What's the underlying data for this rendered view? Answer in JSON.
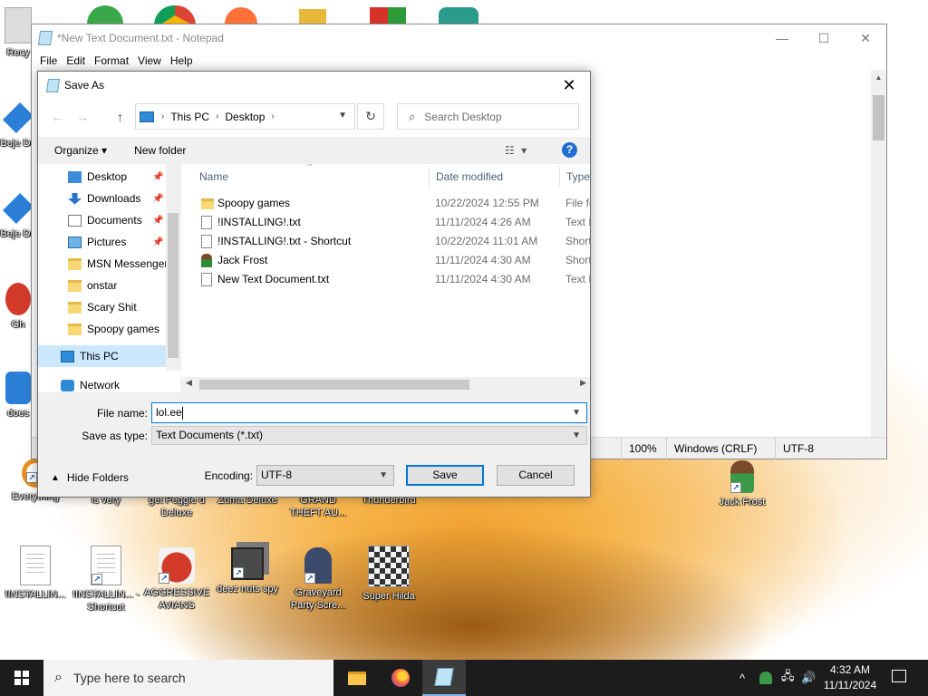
{
  "desktop": {
    "icons": [
      {
        "label": "Recy",
        "color": "#d9d9d9"
      },
      {
        "label": "Beje De",
        "color": "#2b7fd6"
      },
      {
        "label": "Beje De",
        "color": "#2b7fd6"
      },
      {
        "label": "Gh",
        "color": "#d23a2a"
      },
      {
        "label": "does",
        "color": "#2b7fd6"
      },
      {
        "label": "Everything",
        "color": "#e89020"
      },
      {
        "label": "is very",
        "color": "#ffffff"
      },
      {
        "label": "get Peggle d Deluxe",
        "color": "#ffffff"
      },
      {
        "label": "Zuma Deluxe",
        "color": "#ffffff"
      },
      {
        "label": "GRAND THEFT AU...",
        "color": "#ffffff"
      },
      {
        "label": "Thunderbird",
        "color": "#ffffff"
      },
      {
        "label": "Jack Frost",
        "color": "#3a9a4a"
      },
      {
        "label": "!INSTALLIN...",
        "color": "#ffffff"
      },
      {
        "label": "!INSTALLIN... - Shortcut",
        "color": "#ffffff"
      },
      {
        "label": "AGGRESSIVE AVIANS",
        "color": "#d23a2a"
      },
      {
        "label": "deez nuts spy",
        "color": "#555555"
      },
      {
        "label": "Graveyard Party Scre...",
        "color": "#3a4a6a"
      },
      {
        "label": "Super Hilda",
        "color": "#e8e0c0"
      }
    ]
  },
  "notepad": {
    "title": "*New Text Document.txt - Notepad",
    "menu": [
      "File",
      "Edit",
      "Format",
      "View",
      "Help"
    ],
    "status": {
      "zoom": "100%",
      "line_ending": "Windows (CRLF)",
      "encoding": "UTF-8"
    },
    "controls": {
      "minimize": "—",
      "maximize": "☐",
      "close": "✕"
    }
  },
  "save_dialog": {
    "title": "Save As",
    "close": "✕",
    "address": {
      "root": "This PC",
      "folder": "Desktop"
    },
    "search_placeholder": "Search Desktop",
    "organize_label": "Organize ▾",
    "new_folder_label": "New folder",
    "help_label": "?",
    "nav_items": [
      {
        "label": "Desktop",
        "pinned": true,
        "icon": "desktop-icon"
      },
      {
        "label": "Downloads",
        "pinned": true,
        "icon": "downloads-icon"
      },
      {
        "label": "Documents",
        "pinned": true,
        "icon": "documents-icon"
      },
      {
        "label": "Pictures",
        "pinned": true,
        "icon": "pictures-icon"
      },
      {
        "label": "MSN Messenger",
        "pinned": false,
        "icon": "folder-icon"
      },
      {
        "label": "onstar",
        "pinned": false,
        "icon": "folder-icon"
      },
      {
        "label": "Scary Shit",
        "pinned": false,
        "icon": "folder-icon"
      },
      {
        "label": "Spoopy games",
        "pinned": false,
        "icon": "folder-icon"
      },
      {
        "label": "This PC",
        "pinned": false,
        "icon": "this-pc-icon"
      },
      {
        "label": "Network",
        "pinned": false,
        "icon": "network-icon"
      }
    ],
    "columns": {
      "name": "Name",
      "date": "Date modified",
      "type": "Type"
    },
    "files": [
      {
        "name": "Spoopy games",
        "date": "10/22/2024 12:55 PM",
        "type": "File fo",
        "icon": "folder-icon"
      },
      {
        "name": "!INSTALLING!.txt",
        "date": "11/11/2024 4:26 AM",
        "type": "Text D",
        "icon": "text-file-icon"
      },
      {
        "name": "!INSTALLING!.txt - Shortcut",
        "date": "10/22/2024 11:01 AM",
        "type": "Short",
        "icon": "shortcut-icon"
      },
      {
        "name": "Jack Frost",
        "date": "11/11/2024 4:30 AM",
        "type": "Short",
        "icon": "person-icon"
      },
      {
        "name": "New Text Document.txt",
        "date": "11/11/2024 4:30 AM",
        "type": "Text D",
        "icon": "text-file-icon"
      }
    ],
    "file_name_label": "File name:",
    "file_name_value": "lol.ee",
    "save_type_label": "Save as type:",
    "save_type_value": "Text Documents (*.txt)",
    "hide_folders_label": "Hide Folders",
    "encoding_label": "Encoding:",
    "encoding_value": "UTF-8",
    "save_label": "Save",
    "cancel_label": "Cancel"
  },
  "taskbar": {
    "search_placeholder": "Type here to search",
    "time": "4:32 AM",
    "date": "11/11/2024"
  }
}
